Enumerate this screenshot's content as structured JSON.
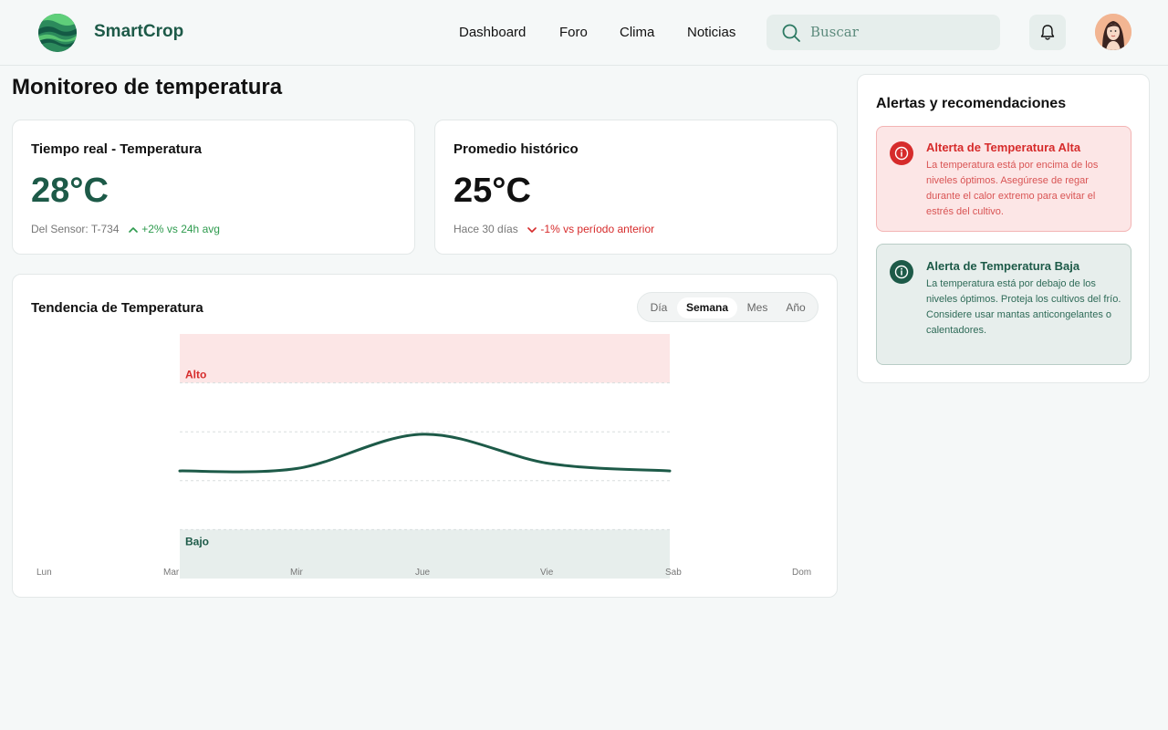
{
  "app": {
    "name": "SmartCrop"
  },
  "nav": {
    "items": [
      "Dashboard",
      "Foro",
      "Clima",
      "Noticias"
    ]
  },
  "search": {
    "placeholder": "Buscar"
  },
  "page": {
    "title": "Monitoreo de temperatura"
  },
  "realtime": {
    "title": "Tiempo real - Temperatura",
    "value": "28°C",
    "source": "Del Sensor: T-734",
    "delta": "+2% vs 24h avg",
    "delta_direction": "up",
    "color": "#1d5a48"
  },
  "historic": {
    "title": "Promedio histórico",
    "value": "25°C",
    "source": "Hace 30 días",
    "delta": "-1% vs período anterior",
    "delta_direction": "down",
    "color": "#111111"
  },
  "trend": {
    "title": "Tendencia de Temperatura",
    "periods": [
      "Día",
      "Semana",
      "Mes",
      "Año"
    ],
    "active_period": "Semana",
    "band_high_label": "Alto",
    "band_low_label": "Bajo"
  },
  "chart_data": {
    "type": "line",
    "categories": [
      "Lun",
      "Mar",
      "Mir",
      "Jue",
      "Vie",
      "Sab",
      "Dom"
    ],
    "series": [
      {
        "values": [
          null,
          4.4,
          4.5,
          5.9,
          4.7,
          4.4,
          null
        ]
      }
    ],
    "ylim": [
      0,
      10
    ],
    "bands": [
      {
        "label": "Alto",
        "from": 8,
        "to": 10,
        "color": "#fce6e6"
      },
      {
        "label": "Bajo",
        "from": 0,
        "to": 2,
        "color": "#e7eeec"
      }
    ],
    "line_color": "#1d5a48",
    "xlabel": "",
    "ylabel": "",
    "grid": true
  },
  "alerts": {
    "title": "Alertas y recomendaciones",
    "items": [
      {
        "title": "Alterta de Temperatura Alta",
        "text": "La temperatura está por encima de los niveles óptimos. Asegúrese de regar durante el calor extremo para evitar el estrés del cultivo.",
        "color": "#d62b2b"
      },
      {
        "title": "Alerta de Temperatura Baja",
        "text": "La temperatura está por debajo de los niveles óptimos. Proteja los cultivos del frío. Considere usar mantas anticongelantes o calentadores.",
        "color": "#1d5a48"
      }
    ]
  },
  "colors": {
    "brand": "#1d5a48",
    "danger": "#d62b2b",
    "success": "#2e9b4e"
  }
}
